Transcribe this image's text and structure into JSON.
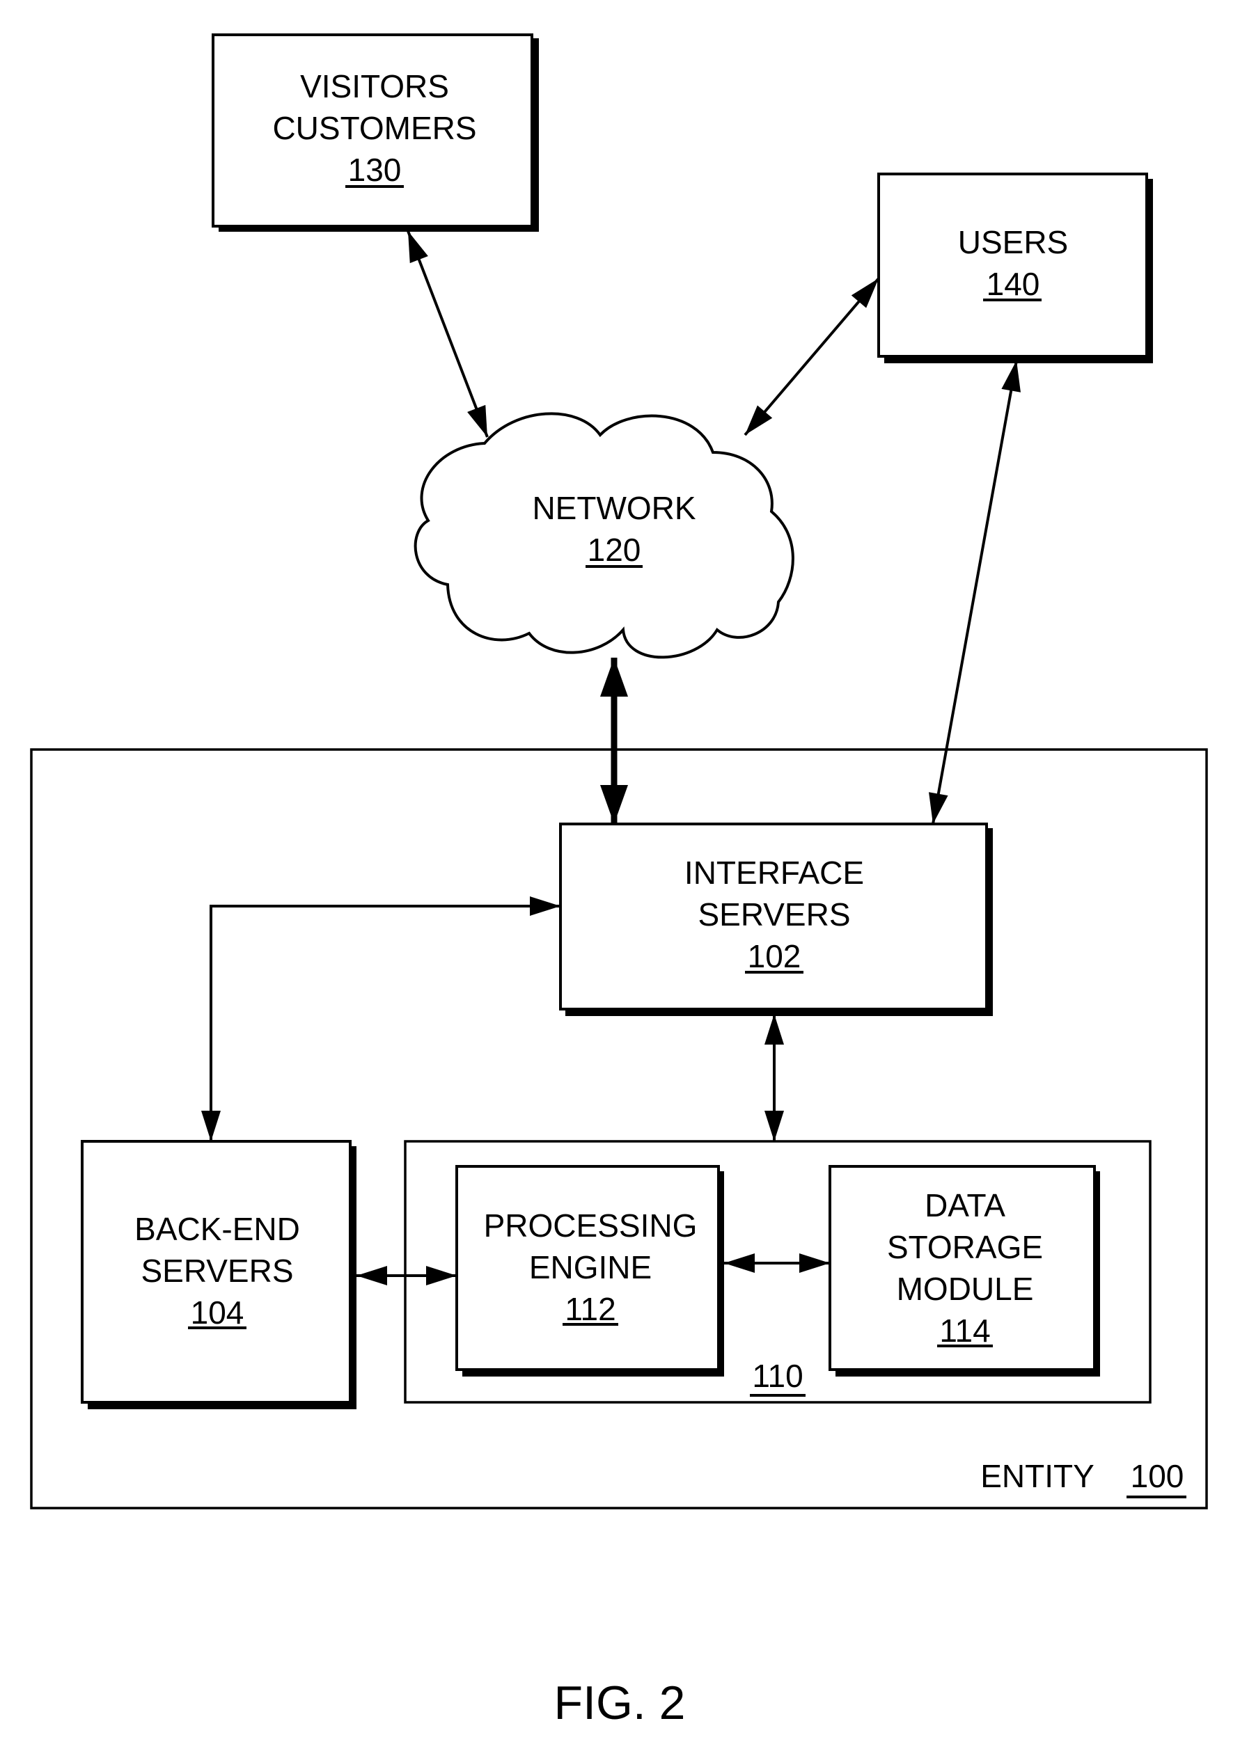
{
  "figure": {
    "caption": "FIG. 2",
    "colors": {
      "ink": "#000000",
      "paper": "#ffffff"
    }
  },
  "nodes": {
    "visitors": {
      "lines": [
        "VISITORS",
        "CUSTOMERS"
      ],
      "ref": "130"
    },
    "users": {
      "lines": [
        "USERS"
      ],
      "ref": "140"
    },
    "network": {
      "lines": [
        "NETWORK"
      ],
      "ref": "120"
    },
    "interface_servers": {
      "lines": [
        "INTERFACE",
        "SERVERS"
      ],
      "ref": "102"
    },
    "backend_servers": {
      "lines": [
        "BACK-END",
        "SERVERS"
      ],
      "ref": "104"
    },
    "processing_engine": {
      "lines": [
        "PROCESSING",
        "ENGINE"
      ],
      "ref": "112"
    },
    "data_storage": {
      "lines": [
        "DATA",
        "STORAGE",
        "MODULE"
      ],
      "ref": "114"
    },
    "subsystem": {
      "ref": "110"
    },
    "entity": {
      "label": "ENTITY",
      "ref": "100"
    }
  },
  "connections": [
    {
      "from": "visitors",
      "to": "network",
      "direction": "bidirectional"
    },
    {
      "from": "users",
      "to": "network",
      "direction": "bidirectional"
    },
    {
      "from": "users",
      "to": "interface_servers",
      "direction": "bidirectional"
    },
    {
      "from": "network",
      "to": "interface_servers",
      "direction": "bidirectional",
      "weight": "heavy"
    },
    {
      "from": "interface_servers",
      "to": "backend_servers",
      "direction": "bidirectional"
    },
    {
      "from": "interface_servers",
      "to": "subsystem",
      "direction": "bidirectional"
    },
    {
      "from": "backend_servers",
      "to": "processing_engine",
      "direction": "bidirectional"
    },
    {
      "from": "processing_engine",
      "to": "data_storage",
      "direction": "bidirectional"
    }
  ]
}
